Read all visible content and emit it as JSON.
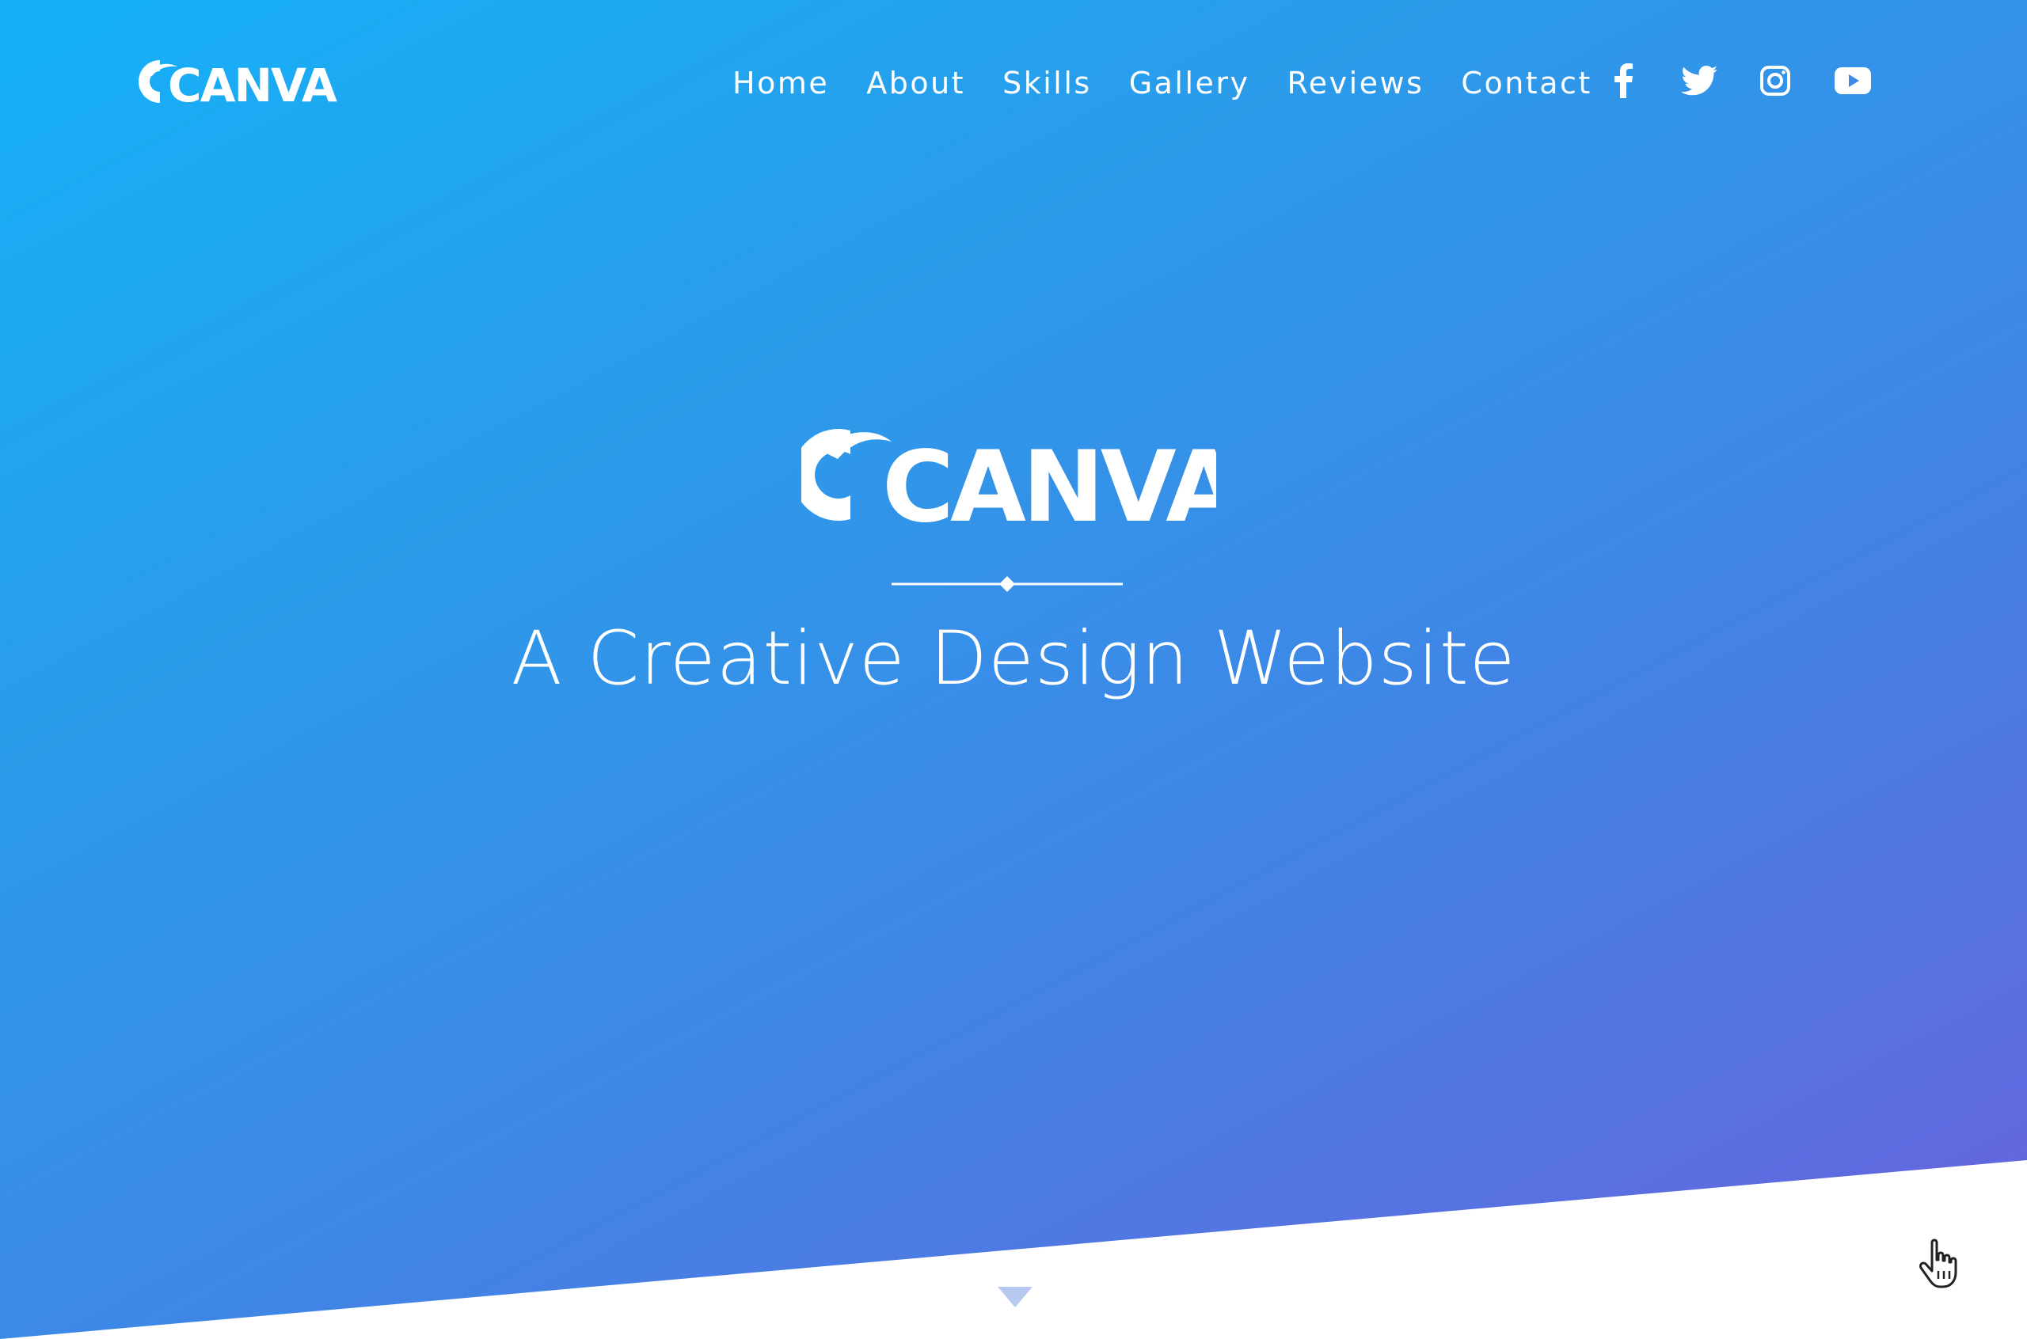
{
  "brand": {
    "name": "CANVAS"
  },
  "nav": {
    "items": [
      {
        "label": "Home"
      },
      {
        "label": "About"
      },
      {
        "label": "Skills"
      },
      {
        "label": "Gallery"
      },
      {
        "label": "Reviews"
      },
      {
        "label": "Contact"
      }
    ]
  },
  "social": {
    "icons": [
      "facebook-icon",
      "twitter-icon",
      "instagram-icon",
      "youtube-icon"
    ]
  },
  "hero": {
    "title": "CANVAS",
    "tagline": "A Creative Design Website"
  },
  "colors": {
    "gradient_start": "#14b1f7",
    "gradient_end": "#6a5fdc",
    "text": "#ffffff",
    "arrow": "#b8c9f0"
  }
}
